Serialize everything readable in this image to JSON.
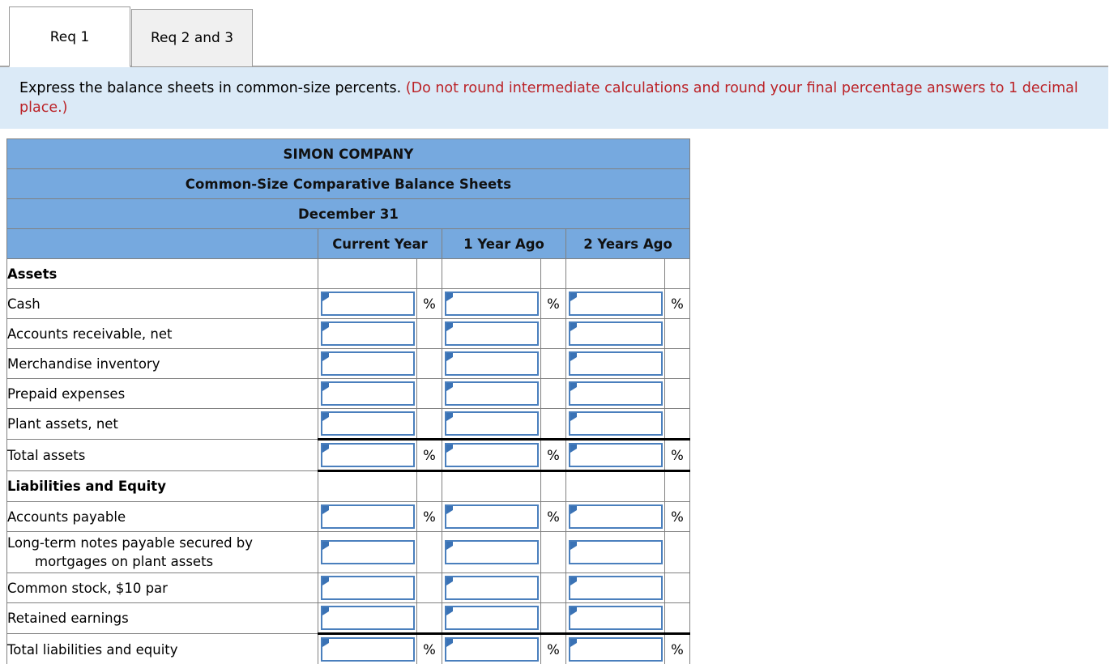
{
  "tabs": [
    {
      "label": "Req 1",
      "active": true
    },
    {
      "label": "Req 2 and 3",
      "active": false
    }
  ],
  "instruction": {
    "main": "Express the balance sheets in common-size percents.",
    "hint": "(Do not round intermediate calculations and round your final percentage answers to 1 decimal place.)"
  },
  "colors": {
    "header_blue": "#76a9df",
    "banner_blue": "#dbeaf7",
    "hint_red": "#bb2227",
    "field_border": "#4a7fbd",
    "grid_gray": "#808080"
  },
  "sheet": {
    "title_lines": [
      "SIMON COMPANY",
      "Common-Size Comparative Balance Sheets",
      "December 31"
    ],
    "column_headers": [
      "Current Year",
      "1 Year Ago",
      "2 Years Ago"
    ],
    "percent_suffix": "%",
    "rows": [
      {
        "label": "Assets",
        "kind": "section",
        "bold": true,
        "inputs": false,
        "percent": false
      },
      {
        "label": "Cash",
        "kind": "item",
        "bold": false,
        "inputs": true,
        "percent": true
      },
      {
        "label": "Accounts receivable, net",
        "kind": "item",
        "bold": false,
        "inputs": true,
        "percent": false
      },
      {
        "label": "Merchandise inventory",
        "kind": "item",
        "bold": false,
        "inputs": true,
        "percent": false
      },
      {
        "label": "Prepaid expenses",
        "kind": "item",
        "bold": false,
        "inputs": true,
        "percent": false
      },
      {
        "label": "Plant assets, net",
        "kind": "item",
        "bold": false,
        "inputs": true,
        "percent": false
      },
      {
        "label": "Total assets",
        "kind": "total",
        "bold": false,
        "inputs": true,
        "percent": true
      },
      {
        "label": "Liabilities and Equity",
        "kind": "section-rule",
        "bold": true,
        "inputs": false,
        "percent": false
      },
      {
        "label": "Accounts payable",
        "kind": "item",
        "bold": false,
        "inputs": true,
        "percent": true
      },
      {
        "label": "Long-term notes payable secured by",
        "label2": "mortgages on plant assets",
        "kind": "item-wrap",
        "bold": false,
        "inputs": true,
        "percent": false
      },
      {
        "label": "Common stock, $10 par",
        "kind": "item",
        "bold": false,
        "inputs": true,
        "percent": false
      },
      {
        "label": "Retained earnings",
        "kind": "item",
        "bold": false,
        "inputs": true,
        "percent": false
      },
      {
        "label": "Total liabilities and equity",
        "kind": "grand",
        "bold": false,
        "inputs": true,
        "percent": true
      }
    ]
  }
}
